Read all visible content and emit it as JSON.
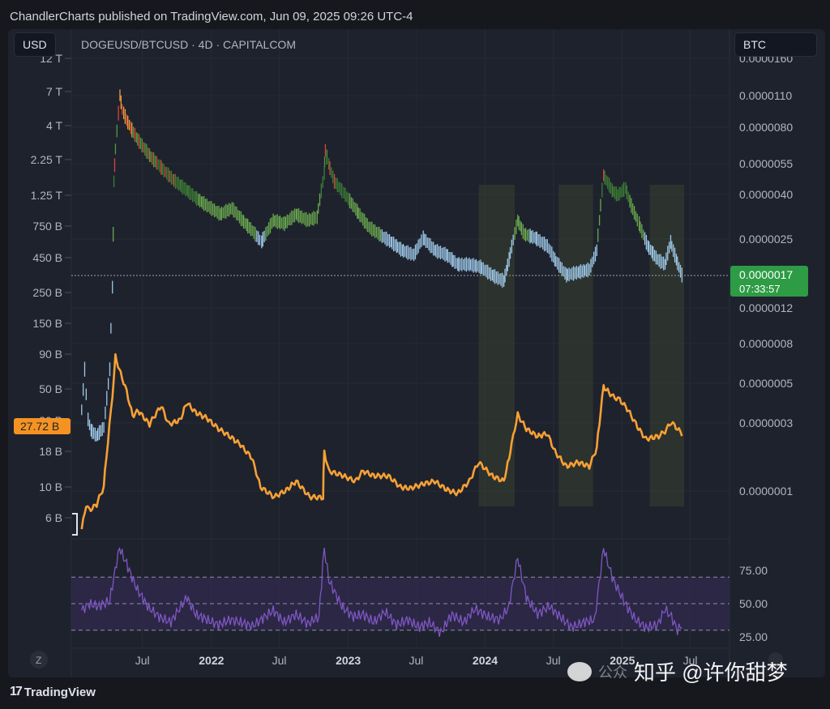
{
  "header": {
    "attribution": "ChandlerCharts published on TradingView.com, Jun 09, 2025 09:26 UTC-4"
  },
  "toolbar": {
    "left_currency": "USD",
    "right_currency": "BTC",
    "symbol": "DOGEUSD/BTCUSD · 4D · CAPITALCOM",
    "z_button": "Z"
  },
  "footer": {
    "brand": "TradingView",
    "logo_mark": "17",
    "watermark_text": "知乎 @许你甜梦",
    "watermark_faint": "公众"
  },
  "colors": {
    "background": "#1e222d",
    "marketcap_line": "#f7a035",
    "rsi_line": "#7e57c2",
    "rsi_band": "#3c2f63",
    "price_tag": "#2e9b45",
    "cap_tag": "#f59322",
    "highlight_zone": "#39402e"
  },
  "chart_data": [
    {
      "type": "line",
      "title": "DOGEUSD/BTCUSD · 4D · CAPITALCOM",
      "x_tick_labels": [
        "Jul",
        "2022",
        "Jul",
        "2023",
        "Jul",
        "2024",
        "Jul",
        "2025",
        "Jul"
      ],
      "left_axis_labels": [
        "12 T",
        "7 T",
        "4 T",
        "2.25 T",
        "1.25 T",
        "750 B",
        "450 B",
        "250 B",
        "150 B",
        "90 B",
        "50 B",
        "30 B",
        "18 B",
        "10 B",
        "6 B"
      ],
      "right_axis_labels": [
        "0.0000160",
        "0.0000110",
        "0.0000080",
        "0.0000055",
        "0.0000040",
        "0.0000025",
        "0.0000012",
        "0.0000008",
        "0.0000005",
        "0.0000003",
        "0.0000001"
      ],
      "price_series": {
        "name": "DOGEUSD/BTCUSD",
        "scale": "log",
        "x": [
          "2021-01-20",
          "2021-01-28",
          "2021-02-06",
          "2021-02-14",
          "2021-03-01",
          "2021-03-20",
          "2021-04-05",
          "2021-04-12",
          "2021-04-16",
          "2021-04-20",
          "2021-05-02",
          "2021-05-08",
          "2021-05-20",
          "2021-06-15",
          "2021-07-20",
          "2021-08-20",
          "2021-09-20",
          "2021-10-28",
          "2021-11-20",
          "2021-12-20",
          "2022-01-25",
          "2022-02-25",
          "2022-03-25",
          "2022-04-20",
          "2022-05-15",
          "2022-06-15",
          "2022-07-15",
          "2022-08-15",
          "2022-09-15",
          "2022-10-10",
          "2022-10-29",
          "2022-11-01",
          "2022-11-10",
          "2022-11-25",
          "2022-12-20",
          "2023-01-25",
          "2023-02-25",
          "2023-03-25",
          "2023-04-25",
          "2023-05-25",
          "2023-06-25",
          "2023-07-20",
          "2023-08-20",
          "2023-09-20",
          "2023-10-20",
          "2023-11-20",
          "2023-12-20",
          "2024-01-20",
          "2024-02-20",
          "2024-03-05",
          "2024-03-28",
          "2024-04-15",
          "2024-05-15",
          "2024-06-15",
          "2024-07-05",
          "2024-08-05",
          "2024-09-05",
          "2024-10-05",
          "2024-10-25",
          "2024-11-12",
          "2024-12-05",
          "2024-12-20",
          "2025-01-10",
          "2025-01-25",
          "2025-02-15",
          "2025-03-10",
          "2025-04-05",
          "2025-04-25",
          "2025-05-10",
          "2025-05-25",
          "2025-06-09"
        ],
        "values": [
          4.2e-07,
          6.4e-07,
          3.8e-07,
          3.4e-07,
          3.2e-07,
          3.5e-07,
          6.4e-07,
          1.5e-06,
          4.5e-06,
          6.3e-06,
          1.1e-05,
          9.5e-06,
          8.5e-06,
          7.1e-06,
          5.9e-06,
          5.2e-06,
          4.6e-06,
          4.1e-06,
          3.8e-06,
          3.5e-06,
          3.2e-06,
          3.4e-06,
          3e-06,
          2.7e-06,
          2.4e-06,
          3e-06,
          2.9e-06,
          3.2e-06,
          3e-06,
          3.1e-06,
          4.9e-06,
          6.2e-06,
          5.4e-06,
          4.5e-06,
          4e-06,
          3.3e-06,
          2.8e-06,
          2.6e-06,
          2.4e-06,
          2.2e-06,
          2.1e-06,
          2.5e-06,
          2.2e-06,
          2.1e-06,
          1.9e-06,
          1.9e-06,
          1.85e-06,
          1.7e-06,
          1.6e-06,
          2e-06,
          3e-06,
          2.6e-06,
          2.5e-06,
          2.3e-06,
          2e-06,
          1.7e-06,
          1.75e-06,
          1.8e-06,
          2.2e-06,
          4.8e-06,
          4.1e-06,
          3.9e-06,
          4.2e-06,
          3.5e-06,
          2.9e-06,
          2.3e-06,
          2e-06,
          1.9e-06,
          2.4e-06,
          2e-06,
          1.7e-06
        ]
      },
      "marketcap_series": {
        "name": "",
        "scale": "log",
        "x": [
          "2021-01-20",
          "2021-02-01",
          "2021-02-10",
          "2021-03-01",
          "2021-03-20",
          "2021-04-12",
          "2021-04-20",
          "2021-05-08",
          "2021-05-20",
          "2021-06-05",
          "2021-06-20",
          "2021-07-20",
          "2021-08-20",
          "2021-09-10",
          "2021-10-10",
          "2021-10-28",
          "2021-11-20",
          "2021-12-20",
          "2022-01-20",
          "2022-02-10",
          "2022-03-20",
          "2022-04-20",
          "2022-05-12",
          "2022-06-18",
          "2022-07-20",
          "2022-08-15",
          "2022-09-20",
          "2022-10-26",
          "2022-10-29",
          "2022-11-10",
          "2022-12-20",
          "2023-01-20",
          "2023-02-10",
          "2023-03-10",
          "2023-04-18",
          "2023-05-20",
          "2023-06-15",
          "2023-07-20",
          "2023-08-20",
          "2023-09-20",
          "2023-10-20",
          "2023-11-20",
          "2023-12-15",
          "2024-01-20",
          "2024-02-20",
          "2024-03-05",
          "2024-03-28",
          "2024-04-20",
          "2024-05-20",
          "2024-06-15",
          "2024-07-05",
          "2024-08-05",
          "2024-09-05",
          "2024-10-05",
          "2024-10-25",
          "2024-11-12",
          "2024-12-08",
          "2024-12-25",
          "2025-01-18",
          "2025-02-10",
          "2025-03-05",
          "2025-04-08",
          "2025-04-25",
          "2025-05-12",
          "2025-05-28",
          "2025-06-09"
        ],
        "values": [
          5.0,
          7.5,
          6.8,
          7.5,
          10,
          45,
          85,
          60,
          48,
          32,
          35,
          28,
          38,
          28,
          30,
          40,
          34,
          31,
          26,
          24,
          20,
          16,
          10,
          8.5,
          9.5,
          11,
          8.5,
          8.4,
          18,
          13,
          12,
          11,
          13,
          12,
          12,
          10,
          9.8,
          10.5,
          11,
          9.6,
          9.0,
          11,
          15,
          12,
          11,
          16,
          33,
          26,
          23,
          24,
          18,
          14,
          15,
          14,
          19,
          52,
          44,
          42,
          35,
          27,
          22,
          23,
          25,
          29,
          26,
          24
        ]
      },
      "current_price": "0.0000017",
      "countdown": "07:33:57",
      "current_marketcap": "27.72 B",
      "highlight_zones": [
        [
          "2023-12-15",
          "2024-03-20"
        ],
        [
          "2024-07-15",
          "2024-10-15"
        ],
        [
          "2025-03-15",
          "2025-06-15"
        ]
      ]
    },
    {
      "type": "line",
      "title": "",
      "y_tick_labels": [
        "75.00",
        "50.00",
        "25.00"
      ],
      "ylim": [
        20,
        95
      ],
      "band": [
        30,
        70
      ],
      "midline": 50,
      "series": [
        {
          "name": "",
          "x": [
            "2021-01-20",
            "2021-02-10",
            "2021-03-05",
            "2021-04-05",
            "2021-04-16",
            "2021-05-01",
            "2021-05-20",
            "2021-06-15",
            "2021-07-15",
            "2021-08-15",
            "2021-09-15",
            "2021-10-28",
            "2021-11-20",
            "2021-12-20",
            "2022-01-20",
            "2022-02-20",
            "2022-03-20",
            "2022-04-20",
            "2022-05-15",
            "2022-06-15",
            "2022-07-15",
            "2022-08-15",
            "2022-09-15",
            "2022-10-15",
            "2022-10-29",
            "2022-11-10",
            "2022-12-15",
            "2023-01-15",
            "2023-02-10",
            "2023-03-10",
            "2023-04-10",
            "2023-05-10",
            "2023-06-10",
            "2023-07-10",
            "2023-08-05",
            "2023-09-05",
            "2023-10-05",
            "2023-11-05",
            "2023-12-05",
            "2024-01-10",
            "2024-02-10",
            "2024-03-05",
            "2024-03-28",
            "2024-04-20",
            "2024-05-20",
            "2024-06-20",
            "2024-07-20",
            "2024-08-20",
            "2024-09-20",
            "2024-10-20",
            "2024-11-12",
            "2024-12-05",
            "2025-01-05",
            "2025-02-05",
            "2025-03-05",
            "2025-04-05",
            "2025-04-25",
            "2025-05-12",
            "2025-05-28",
            "2025-06-09"
          ],
          "values": [
            45,
            50,
            48,
            52,
            70,
            92,
            80,
            62,
            48,
            40,
            36,
            55,
            42,
            38,
            34,
            38,
            36,
            33,
            38,
            45,
            36,
            42,
            35,
            40,
            92,
            68,
            48,
            40,
            42,
            36,
            44,
            34,
            38,
            32,
            36,
            28,
            42,
            36,
            46,
            40,
            38,
            48,
            85,
            55,
            42,
            48,
            40,
            32,
            36,
            38,
            92,
            70,
            52,
            38,
            32,
            34,
            46,
            40,
            30,
            34
          ]
        }
      ]
    }
  ]
}
